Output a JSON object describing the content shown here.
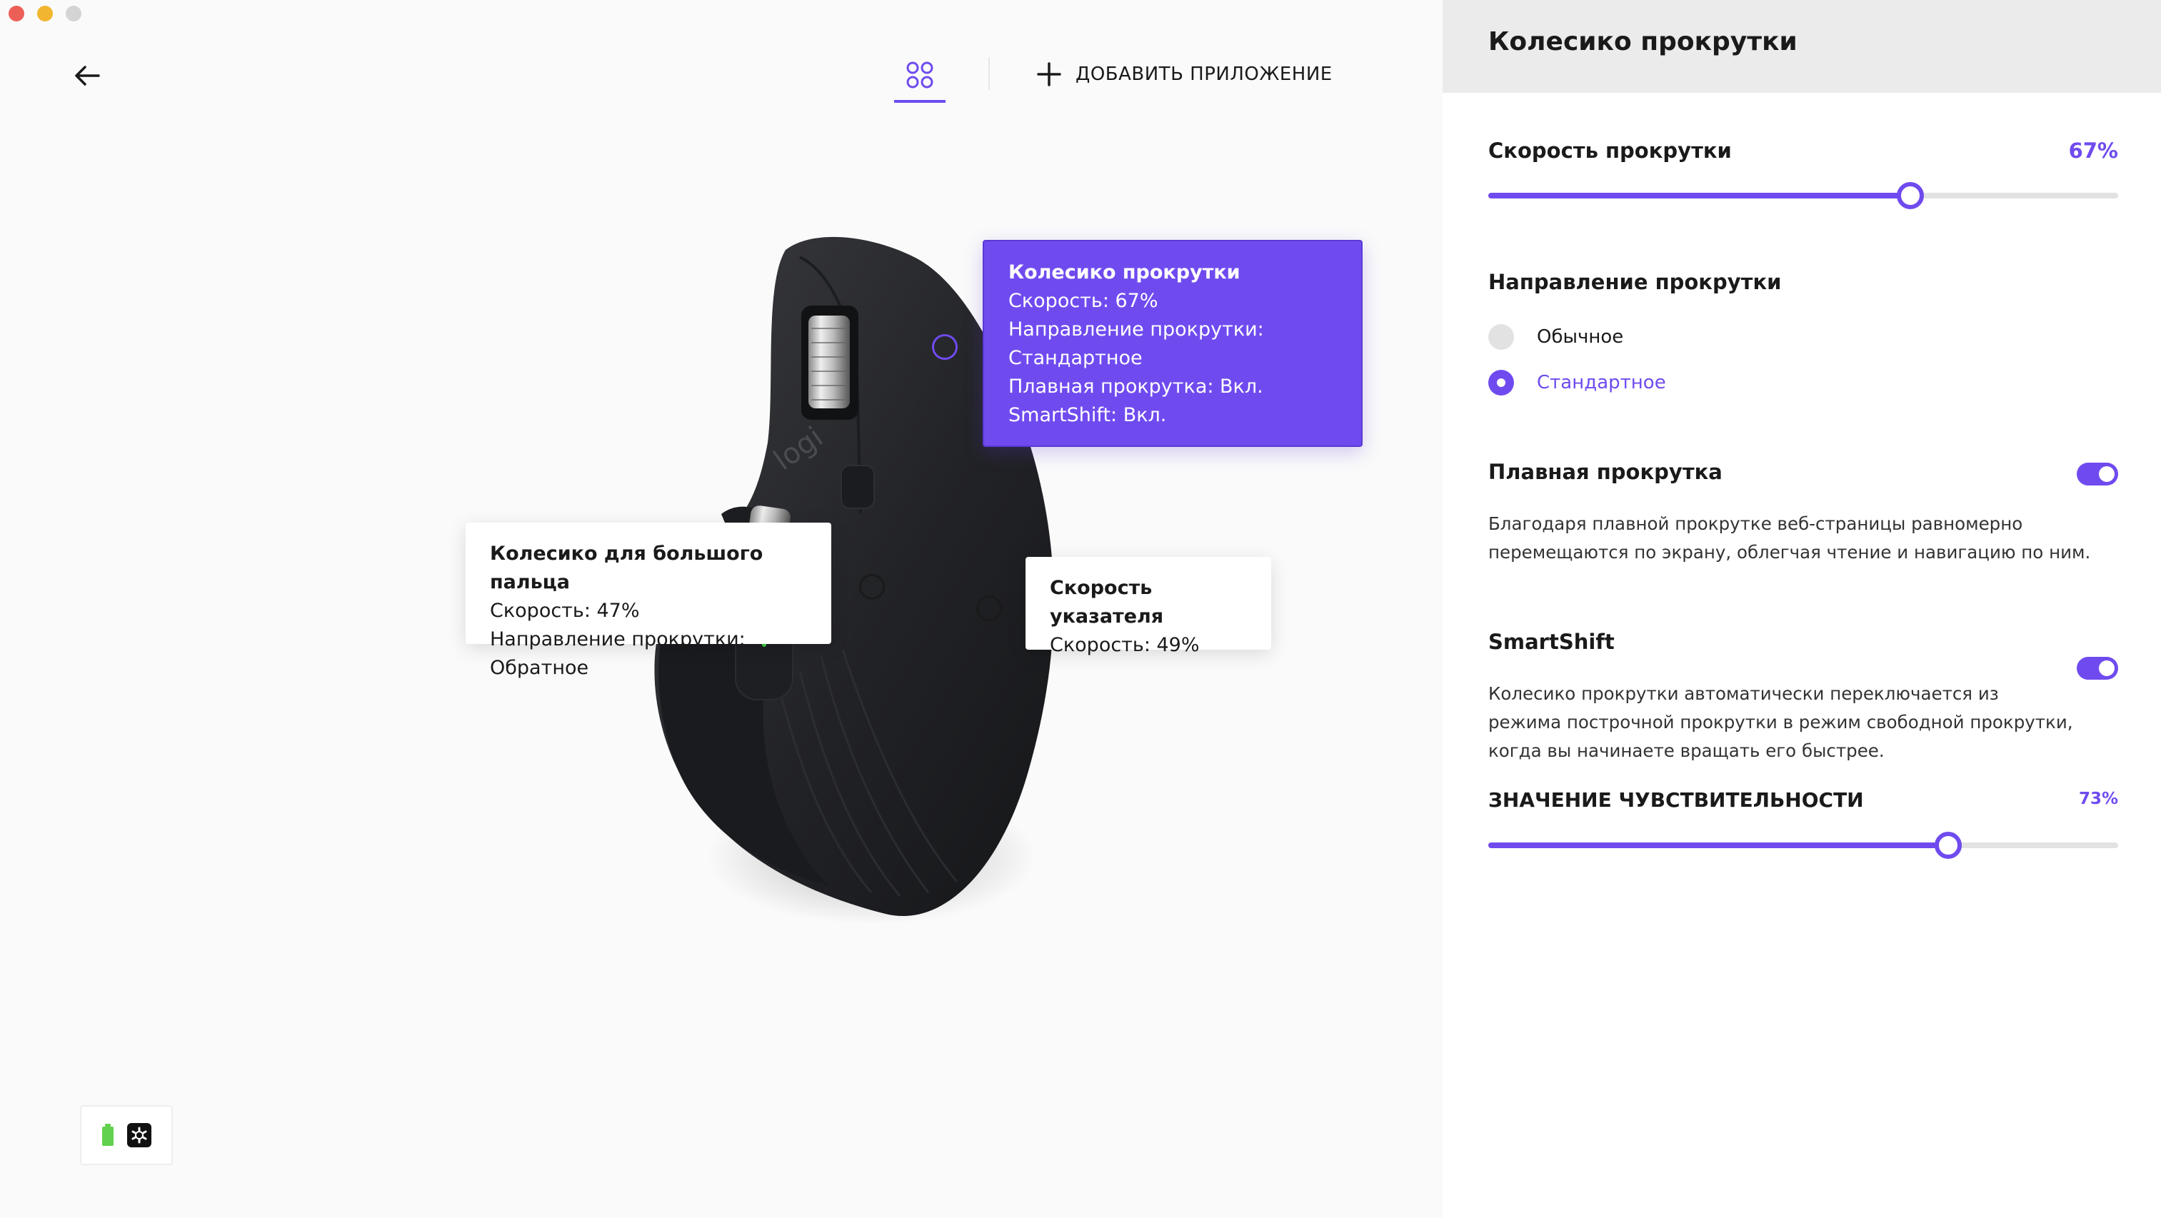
{
  "window": {
    "controls": [
      "close",
      "minimize",
      "maximize"
    ]
  },
  "topbar": {
    "back_icon": "arrow-left-icon",
    "apps_icon": "grid-icon",
    "add_app_icon": "plus-icon",
    "add_app_label": "ДОБАВИТЬ ПРИЛОЖЕНИЕ"
  },
  "tooltips": {
    "thumb_wheel": {
      "title": "Колесико для большого пальца",
      "speed": "Скорость: 47%",
      "direction": "Направление прокрутки: Обратное"
    },
    "pointer": {
      "title": "Скорость указателя",
      "speed": "Скорость: 49%"
    },
    "scroll_wheel": {
      "title": "Колесико прокрутки",
      "speed": "Скорость: 67%",
      "direction_label": "Направление прокрутки:",
      "direction_value": "Стандартное",
      "smooth": "Плавная прокрутка: Вкл.",
      "smartshift": "SmartShift: Вкл."
    }
  },
  "device_status": {
    "battery_icon": "battery-icon",
    "receiver_icon": "unifying-receiver-icon"
  },
  "panel": {
    "title": "Колесико прокрутки",
    "scroll_speed": {
      "label": "Скорость прокрутки",
      "value_text": "67%",
      "value": 67
    },
    "direction": {
      "label": "Направление прокрутки",
      "options": [
        {
          "label": "Обычное",
          "selected": false
        },
        {
          "label": "Стандартное",
          "selected": true
        }
      ]
    },
    "smooth": {
      "label": "Плавная прокрутка",
      "enabled": true,
      "description": "Благодаря плавной прокрутке веб-страницы равномерно перемещаются по экрану, облегчая чтение и навигацию по ним."
    },
    "smartshift": {
      "label": "SmartShift",
      "enabled": true,
      "description": "Колесико прокрутки автоматически переключается из режима построчной прокрутки в режим свободной прокрутки, когда вы начинаете вращать его быстрее."
    },
    "sensitivity": {
      "label": "ЗНАЧЕНИЕ ЧУВСТВИТЕЛЬНОСТИ",
      "value_text": "73%",
      "value": 73
    }
  },
  "colors": {
    "accent": "#6f4bef",
    "panel_header": "#ebebeb",
    "background": "#fafafa"
  }
}
